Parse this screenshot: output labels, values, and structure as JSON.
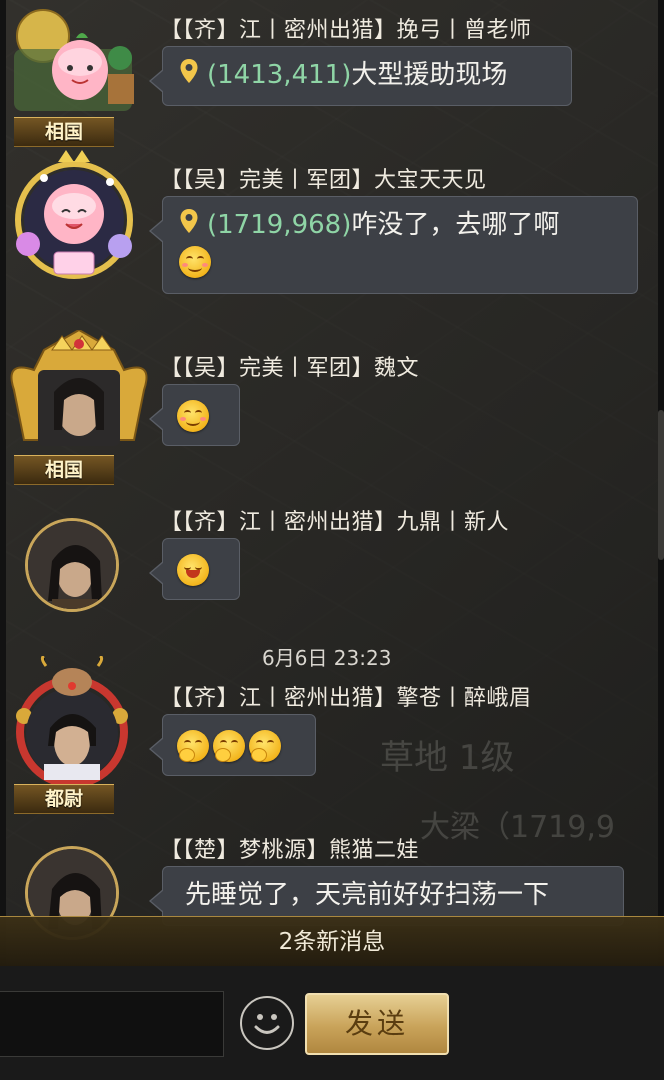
{
  "messages": [
    {
      "sender": "【【齐】江丨密州出猎】挽弓丨曾老师",
      "rank": "相国",
      "coord": "(1413,411)",
      "text": "大型援助现场",
      "avatar": "peach-avatar-gold-frame"
    },
    {
      "sender": "【【吴】完美丨军团】大宝天天见",
      "rank": "",
      "coord": "(1719,968)",
      "text": "咋没了，去哪了啊",
      "emojis": [
        "smile-emoji"
      ],
      "avatar": "peach-avatar-birthday-frame"
    },
    {
      "sender": "【【吴】完美丨军团】魏文",
      "rank": "相国",
      "emojis": [
        "smile-emoji"
      ],
      "avatar": "warrior-avatar-crown-frame"
    },
    {
      "sender": "【【齐】江丨密州出猎】九鼎丨新人",
      "rank": "",
      "emojis": [
        "grin-emoji"
      ],
      "avatar": "warrior-avatar-round"
    },
    {
      "timestamp": "6月6日 23:23",
      "sender": "【【齐】江丨密州出猎】擎苍丨醉峨眉",
      "rank": "都尉",
      "emojis": [
        "sleepy-emoji",
        "sleepy-emoji",
        "sleepy-emoji"
      ],
      "avatar": "warrior-avatar-reindeer-frame"
    },
    {
      "sender": "【【楚】梦桃源】熊猫二娃",
      "rank": "",
      "text": "先睡觉了，天亮前好好扫荡一下",
      "avatar": "warrior-avatar-round"
    }
  ],
  "background_map": {
    "tile_label": "草地 1级",
    "location_label": "大梁（1719,9"
  },
  "new_messages_label": "2条新消息",
  "send_label": "发送",
  "colors": {
    "coord_green": "#8fd5a6",
    "bubble_bg": "#3d4046",
    "send_gold": "#c9a35a"
  }
}
